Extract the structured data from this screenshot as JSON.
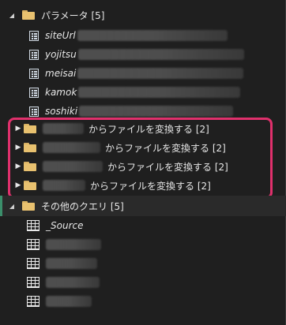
{
  "panel": {
    "params_group": {
      "label": "パラメータ [5]",
      "items": [
        {
          "label": "siteUrl"
        },
        {
          "label": "yojitsu"
        },
        {
          "label": "meisai"
        },
        {
          "label": "kamok"
        },
        {
          "label": "soshiki"
        }
      ]
    },
    "transform_items": [
      {
        "suffix": "からファイルを変換する [2]"
      },
      {
        "suffix": "からファイルを変換する [2]"
      },
      {
        "suffix": "からファイルを変換する [2]"
      },
      {
        "suffix": "からファイルを変換する [2]"
      }
    ],
    "other_queries_group": {
      "label": "その他のクエリ [5]",
      "items": [
        {
          "label": "_Source"
        }
      ]
    }
  },
  "colors": {
    "background": "#1f1f1f",
    "highlight_border": "#e0306c",
    "folder": "#e8c16f",
    "selected_indicator": "#3b8f6b"
  },
  "icons": {
    "folder": "folder-icon",
    "parameter": "parameter-icon",
    "table": "table-icon",
    "expand": "caret-right-icon",
    "collapse": "caret-down-icon"
  }
}
